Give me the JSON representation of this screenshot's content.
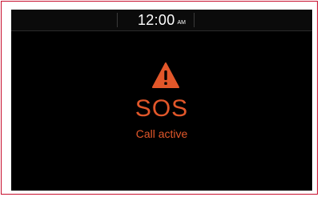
{
  "status_bar": {
    "time": "12:00",
    "ampm": "AM"
  },
  "alert": {
    "icon": "warning-triangle-icon",
    "title": "SOS",
    "subtitle": "Call active"
  },
  "colors": {
    "accent": "#e2572a",
    "background": "#000000",
    "frame_border": "#c8102e"
  }
}
